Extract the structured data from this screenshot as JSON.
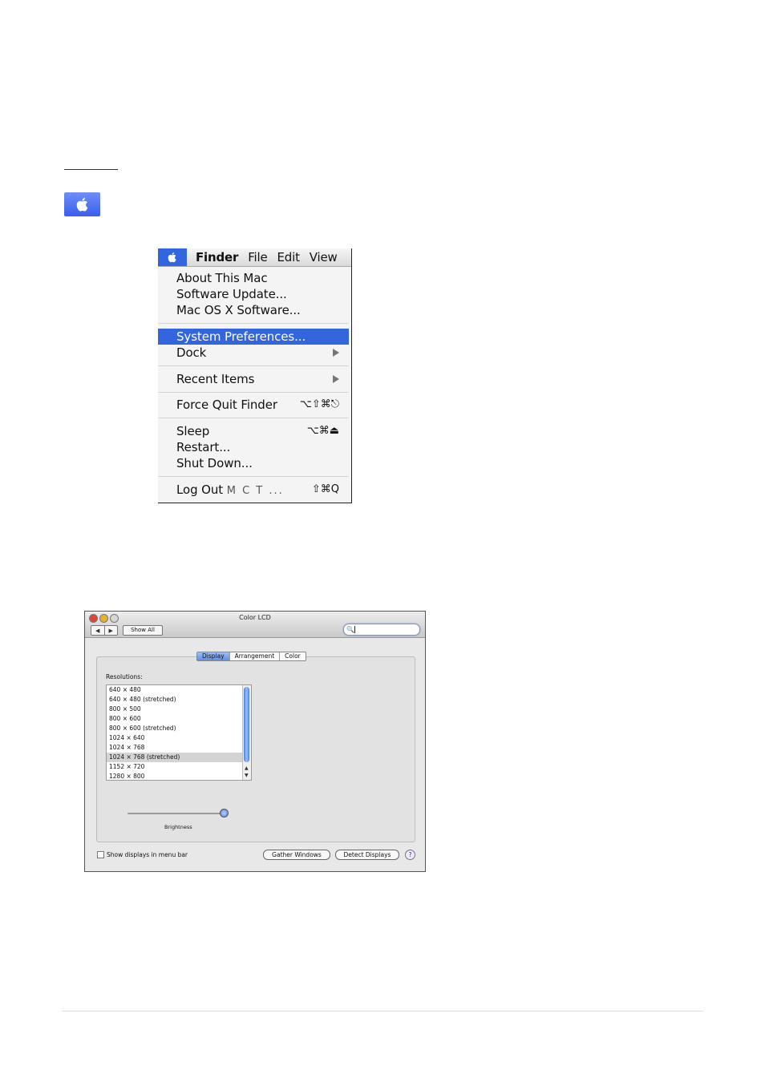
{
  "apple_menu": {
    "menubar": [
      "Finder",
      "File",
      "Edit",
      "View"
    ],
    "items": [
      {
        "label": "About This Mac"
      },
      {
        "label": "Software Update..."
      },
      {
        "label": "Mac OS X Software..."
      },
      {
        "label": "System Preferences...",
        "highlighted": true
      },
      {
        "label": "Dock",
        "submenu": true
      },
      {
        "label": "Recent Items",
        "submenu": true
      },
      {
        "label": "Force Quit Finder",
        "shortcut": "⌥⇧⌘⎋"
      },
      {
        "label": "Sleep",
        "shortcut": "⌥⌘⏏"
      },
      {
        "label": "Restart..."
      },
      {
        "label": "Shut Down..."
      },
      {
        "label": "Log Out",
        "suffix": "M C T ...",
        "shortcut": "⇧⌘Q"
      }
    ]
  },
  "prefs_window": {
    "title": "Color LCD",
    "show_all": "Show All",
    "nav_back": "◀",
    "nav_forward": "▶",
    "search_icon": "🔍",
    "tabs": [
      "Display",
      "Arrangement",
      "Color"
    ],
    "selected_tab": "Display",
    "resolutions_label": "Resolutions:",
    "resolutions": [
      "640 × 480",
      "640 × 480 (stretched)",
      "800 × 500",
      "800 × 600",
      "800 × 600 (stretched)",
      "1024 × 640",
      "1024 × 768",
      "1024 × 768 (stretched)",
      "1152 × 720",
      "1280 × 800"
    ],
    "selected_resolution": "1024 × 768 (stretched)",
    "brightness_label": "Brightness",
    "brightness_level": 1.0,
    "show_displays_label": "Show displays in menu bar",
    "gather_windows": "Gather Windows",
    "detect_displays": "Detect Displays",
    "help": "?"
  },
  "colors": {
    "menu_highlight": "#3366dd",
    "apple_tile": "#4a6cf2"
  }
}
